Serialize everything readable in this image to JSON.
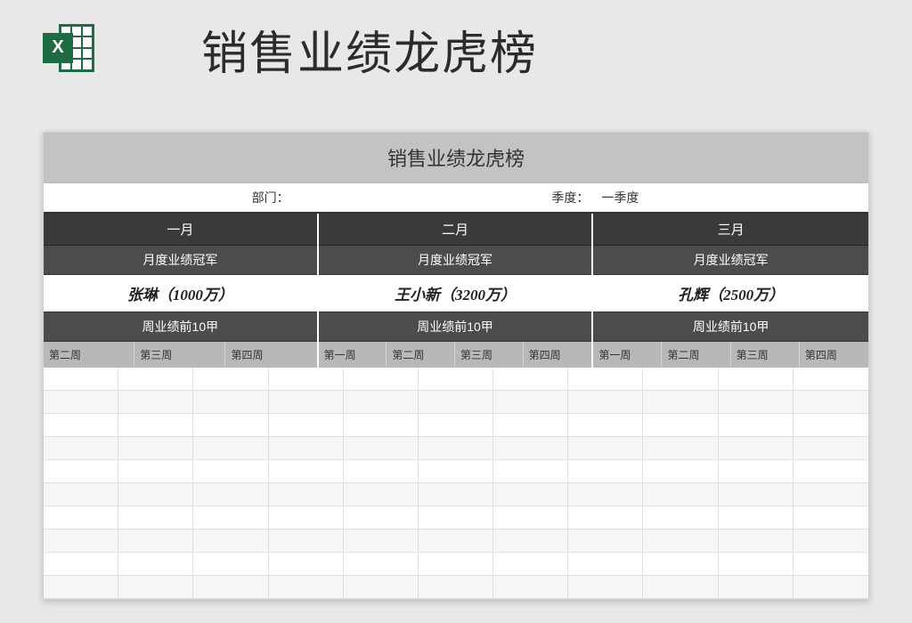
{
  "header": {
    "page_title": "销售业绩龙虎榜",
    "icon_letter": "X"
  },
  "sheet": {
    "title": "销售业绩龙虎榜",
    "dept_label": "部门：",
    "quarter_label": "季度：",
    "quarter_value": "一季度"
  },
  "months": [
    {
      "name": "一月",
      "champ_label": "月度业绩冠军",
      "champion": "张琳（1000万）",
      "week_label": "周业绩前10甲",
      "weeks": [
        "第二周",
        "第三周",
        "第四周"
      ]
    },
    {
      "name": "二月",
      "champ_label": "月度业绩冠军",
      "champion": "王小新（3200万）",
      "week_label": "周业绩前10甲",
      "weeks": [
        "第一周",
        "第二周",
        "第三周",
        "第四周"
      ]
    },
    {
      "name": "三月",
      "champ_label": "月度业绩冠军",
      "champion": "孔辉（2500万）",
      "week_label": "周业绩前10甲",
      "weeks": [
        "第一周",
        "第二周",
        "第三周",
        "第四周"
      ]
    }
  ]
}
